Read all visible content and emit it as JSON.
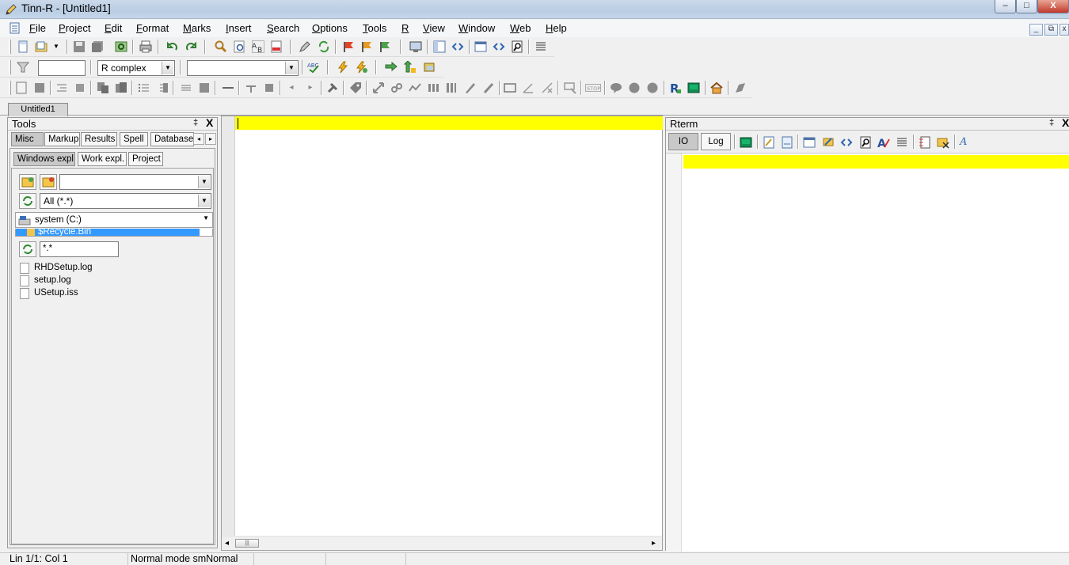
{
  "window": {
    "title": "Tinn-R - [Untitled1]",
    "minimize_glyph": "–",
    "maximize_glyph": "□",
    "close_glyph": "X"
  },
  "menu": {
    "items": [
      "File",
      "Project",
      "Edit",
      "Format",
      "Marks",
      "Insert",
      "Search",
      "Options",
      "Tools",
      "R",
      "View",
      "Window",
      "Web",
      "Help"
    ],
    "mdi_minimize": "_",
    "mdi_restore": "⧉",
    "mdi_close": "x"
  },
  "toolbar2": {
    "filter_value": "",
    "syntax_combo": "R complex",
    "second_combo": ""
  },
  "doc_tabs": [
    "Untitled1"
  ],
  "tools_panel": {
    "title": "Tools",
    "pin": "‡",
    "close": "X",
    "tabs": [
      "Misc",
      "Markup",
      "Results",
      "Spell",
      "Database"
    ],
    "active_tab": "Misc",
    "subtabs": [
      "Windows expl.",
      "Work expl.",
      "Project"
    ],
    "active_subtab": "Windows expl.",
    "folder_combo": "",
    "file_filter_combo": "All (*.*)",
    "drive_combo": "system (C:)",
    "selected_folder": "$Recycle.Bin",
    "mask_value": "*.*",
    "files": [
      "RHDSetup.log",
      "setup.log",
      "USetup.iss"
    ]
  },
  "editor": {
    "scroll_left": "◂",
    "scroll_right": "▸",
    "scroll_thumb": "|||"
  },
  "rterm_panel": {
    "title": "Rterm",
    "pin": "‡",
    "close": "X",
    "tabs": [
      "IO",
      "Log"
    ],
    "active_tab": "IO"
  },
  "status": {
    "position": "Lin 1/1: Col 1",
    "mode": "Normal mode smNormal"
  },
  "colors": {
    "highlight_line": "#ffff00",
    "selection": "#3399ff"
  },
  "icons": [
    "pencil-app-icon",
    "new-file-icon",
    "open-file-icon",
    "save-icon",
    "print-icon",
    "undo-icon",
    "redo-icon",
    "find-icon",
    "replace-icon",
    "filter-icon",
    "spellcheck-icon",
    "send-r-icon",
    "r-logo-icon",
    "home-icon"
  ]
}
